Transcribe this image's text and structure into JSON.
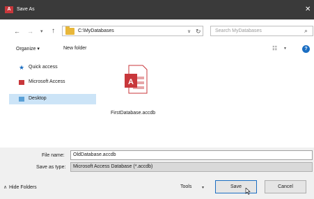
{
  "window": {
    "app_badge": "A",
    "title": "Save As",
    "close_glyph": "✕"
  },
  "address": {
    "path": "C:\\MyDatabases",
    "search_placeholder": "Search MyDatabases"
  },
  "toolbar": {
    "organize_label": "Organize ▾",
    "new_folder_label": "New folder"
  },
  "nav": {
    "items": [
      {
        "label": "Quick access",
        "icon": "star-icon"
      },
      {
        "label": "Microsoft Access",
        "icon": "access-icon"
      },
      {
        "label": "Desktop",
        "icon": "desktop-icon",
        "selected": true
      }
    ]
  },
  "files": [
    {
      "name": "FirstDatabase.accdb",
      "icon": "access-file-icon"
    }
  ],
  "form": {
    "file_name_label": "File name:",
    "file_name_value": "OldDatabase.accdb",
    "save_type_label": "Save as type:",
    "save_type_value": "Microsoft Access Database (*.accdb)"
  },
  "footer": {
    "hide_folders_label": "Hide Folders",
    "tools_label": "Tools",
    "save_label": "Save",
    "cancel_label": "Cancel"
  },
  "colors": {
    "titlebar": "#3a3a3a",
    "access_red": "#c8373b",
    "selection": "#cce4f7",
    "accent_blue": "#1b6ec2"
  }
}
